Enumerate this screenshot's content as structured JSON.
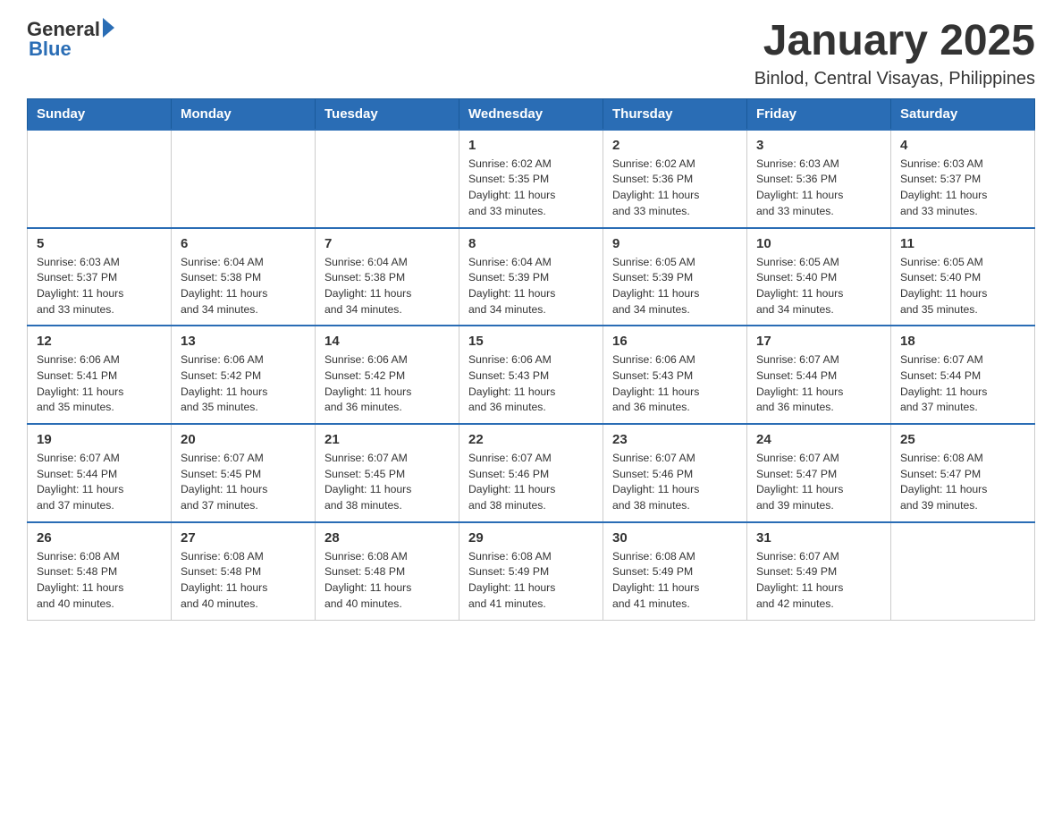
{
  "header": {
    "logo_general": "General",
    "logo_blue": "Blue",
    "main_title": "January 2025",
    "subtitle": "Binlod, Central Visayas, Philippines"
  },
  "calendar": {
    "days_of_week": [
      "Sunday",
      "Monday",
      "Tuesday",
      "Wednesday",
      "Thursday",
      "Friday",
      "Saturday"
    ],
    "weeks": [
      {
        "days": [
          {
            "num": "",
            "info": ""
          },
          {
            "num": "",
            "info": ""
          },
          {
            "num": "",
            "info": ""
          },
          {
            "num": "1",
            "info": "Sunrise: 6:02 AM\nSunset: 5:35 PM\nDaylight: 11 hours\nand 33 minutes."
          },
          {
            "num": "2",
            "info": "Sunrise: 6:02 AM\nSunset: 5:36 PM\nDaylight: 11 hours\nand 33 minutes."
          },
          {
            "num": "3",
            "info": "Sunrise: 6:03 AM\nSunset: 5:36 PM\nDaylight: 11 hours\nand 33 minutes."
          },
          {
            "num": "4",
            "info": "Sunrise: 6:03 AM\nSunset: 5:37 PM\nDaylight: 11 hours\nand 33 minutes."
          }
        ]
      },
      {
        "days": [
          {
            "num": "5",
            "info": "Sunrise: 6:03 AM\nSunset: 5:37 PM\nDaylight: 11 hours\nand 33 minutes."
          },
          {
            "num": "6",
            "info": "Sunrise: 6:04 AM\nSunset: 5:38 PM\nDaylight: 11 hours\nand 34 minutes."
          },
          {
            "num": "7",
            "info": "Sunrise: 6:04 AM\nSunset: 5:38 PM\nDaylight: 11 hours\nand 34 minutes."
          },
          {
            "num": "8",
            "info": "Sunrise: 6:04 AM\nSunset: 5:39 PM\nDaylight: 11 hours\nand 34 minutes."
          },
          {
            "num": "9",
            "info": "Sunrise: 6:05 AM\nSunset: 5:39 PM\nDaylight: 11 hours\nand 34 minutes."
          },
          {
            "num": "10",
            "info": "Sunrise: 6:05 AM\nSunset: 5:40 PM\nDaylight: 11 hours\nand 34 minutes."
          },
          {
            "num": "11",
            "info": "Sunrise: 6:05 AM\nSunset: 5:40 PM\nDaylight: 11 hours\nand 35 minutes."
          }
        ]
      },
      {
        "days": [
          {
            "num": "12",
            "info": "Sunrise: 6:06 AM\nSunset: 5:41 PM\nDaylight: 11 hours\nand 35 minutes."
          },
          {
            "num": "13",
            "info": "Sunrise: 6:06 AM\nSunset: 5:42 PM\nDaylight: 11 hours\nand 35 minutes."
          },
          {
            "num": "14",
            "info": "Sunrise: 6:06 AM\nSunset: 5:42 PM\nDaylight: 11 hours\nand 36 minutes."
          },
          {
            "num": "15",
            "info": "Sunrise: 6:06 AM\nSunset: 5:43 PM\nDaylight: 11 hours\nand 36 minutes."
          },
          {
            "num": "16",
            "info": "Sunrise: 6:06 AM\nSunset: 5:43 PM\nDaylight: 11 hours\nand 36 minutes."
          },
          {
            "num": "17",
            "info": "Sunrise: 6:07 AM\nSunset: 5:44 PM\nDaylight: 11 hours\nand 36 minutes."
          },
          {
            "num": "18",
            "info": "Sunrise: 6:07 AM\nSunset: 5:44 PM\nDaylight: 11 hours\nand 37 minutes."
          }
        ]
      },
      {
        "days": [
          {
            "num": "19",
            "info": "Sunrise: 6:07 AM\nSunset: 5:44 PM\nDaylight: 11 hours\nand 37 minutes."
          },
          {
            "num": "20",
            "info": "Sunrise: 6:07 AM\nSunset: 5:45 PM\nDaylight: 11 hours\nand 37 minutes."
          },
          {
            "num": "21",
            "info": "Sunrise: 6:07 AM\nSunset: 5:45 PM\nDaylight: 11 hours\nand 38 minutes."
          },
          {
            "num": "22",
            "info": "Sunrise: 6:07 AM\nSunset: 5:46 PM\nDaylight: 11 hours\nand 38 minutes."
          },
          {
            "num": "23",
            "info": "Sunrise: 6:07 AM\nSunset: 5:46 PM\nDaylight: 11 hours\nand 38 minutes."
          },
          {
            "num": "24",
            "info": "Sunrise: 6:07 AM\nSunset: 5:47 PM\nDaylight: 11 hours\nand 39 minutes."
          },
          {
            "num": "25",
            "info": "Sunrise: 6:08 AM\nSunset: 5:47 PM\nDaylight: 11 hours\nand 39 minutes."
          }
        ]
      },
      {
        "days": [
          {
            "num": "26",
            "info": "Sunrise: 6:08 AM\nSunset: 5:48 PM\nDaylight: 11 hours\nand 40 minutes."
          },
          {
            "num": "27",
            "info": "Sunrise: 6:08 AM\nSunset: 5:48 PM\nDaylight: 11 hours\nand 40 minutes."
          },
          {
            "num": "28",
            "info": "Sunrise: 6:08 AM\nSunset: 5:48 PM\nDaylight: 11 hours\nand 40 minutes."
          },
          {
            "num": "29",
            "info": "Sunrise: 6:08 AM\nSunset: 5:49 PM\nDaylight: 11 hours\nand 41 minutes."
          },
          {
            "num": "30",
            "info": "Sunrise: 6:08 AM\nSunset: 5:49 PM\nDaylight: 11 hours\nand 41 minutes."
          },
          {
            "num": "31",
            "info": "Sunrise: 6:07 AM\nSunset: 5:49 PM\nDaylight: 11 hours\nand 42 minutes."
          },
          {
            "num": "",
            "info": ""
          }
        ]
      }
    ]
  }
}
